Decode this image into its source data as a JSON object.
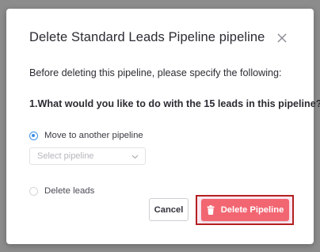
{
  "dialog": {
    "title": "Delete Standard Leads Pipeline pipeline",
    "intro": "Before deleting this pipeline, please specify the following:",
    "question": "1.What would you like to do with the 15 leads in this pipeline?",
    "options": [
      {
        "label": "Move to another pipeline",
        "checked": true
      },
      {
        "label": "Delete leads",
        "checked": false
      }
    ],
    "select": {
      "placeholder": "Select pipeline"
    },
    "buttons": {
      "cancel": "Cancel",
      "delete": "Delete Pipeline"
    },
    "icons": {
      "close": "close-icon",
      "chevron": "chevron-down-icon",
      "trash": "trash-icon"
    },
    "colors": {
      "accent": "#3d8ee6",
      "danger": "#f26672",
      "highlight_border": "#b32020"
    }
  }
}
